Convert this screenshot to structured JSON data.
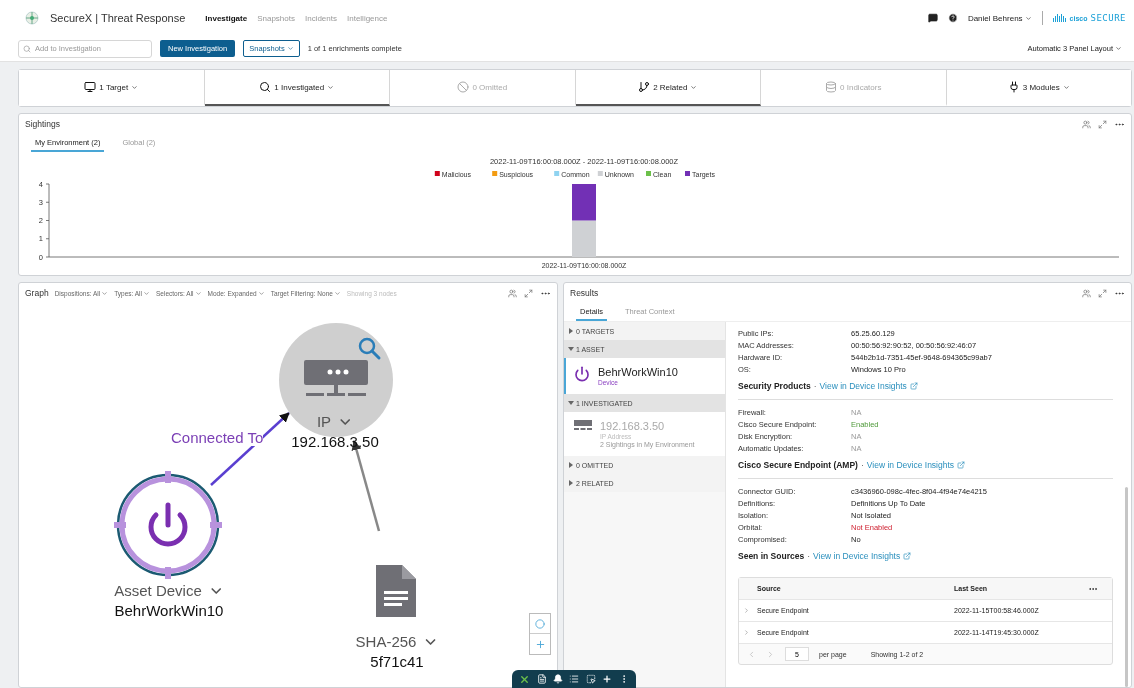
{
  "header": {
    "app_title": "SecureX | Threat Response",
    "nav": [
      {
        "label": "Investigate",
        "selected": true
      },
      {
        "label": "Snapshots",
        "selected": false
      },
      {
        "label": "Incidents",
        "selected": false
      },
      {
        "label": "Intelligence",
        "selected": false
      }
    ],
    "user": "Daniel Behrens",
    "brand_small": "cisco",
    "brand": "SECURE"
  },
  "toolbar": {
    "search_placeholder": "Add to Investigation",
    "new_button": "New Investigation",
    "snapshots_button": "Snapshots",
    "status": "1 of 1 enrichments complete",
    "layout": "Automatic 3 Panel Layout"
  },
  "summary": [
    {
      "kind": "target",
      "label": "1 Target",
      "selected": false,
      "disabled": false
    },
    {
      "kind": "investigated",
      "label": "1 Investigated",
      "selected": true,
      "disabled": false
    },
    {
      "kind": "omitted",
      "label": "0 Omitted",
      "selected": false,
      "disabled": true
    },
    {
      "kind": "related",
      "label": "2 Related",
      "selected": true,
      "disabled": false
    },
    {
      "kind": "indicators",
      "label": "0 Indicators",
      "selected": false,
      "disabled": true
    },
    {
      "kind": "modules",
      "label": "3 Modules",
      "selected": false,
      "disabled": false
    }
  ],
  "sightings": {
    "title": "Sightings",
    "tabs": [
      {
        "label": "My Environment (2)",
        "selected": true
      },
      {
        "label": "Global (2)",
        "selected": false
      }
    ],
    "chart_data": {
      "type": "bar",
      "title": "2022-11-09T16:00:08.000Z - 2022-11-09T16:00:08.000Z",
      "categories": [
        "2022-11-09T16:00:08.000Z"
      ],
      "stacked": true,
      "ylim": [
        0,
        4
      ],
      "yticks": [
        0,
        1,
        2,
        3,
        4
      ],
      "legend": "top",
      "series": [
        {
          "name": "Malicious",
          "color": "#d0021b",
          "values": [
            0
          ]
        },
        {
          "name": "Suspicious",
          "color": "#f39c12",
          "values": [
            0
          ]
        },
        {
          "name": "Common",
          "color": "#8fd3f0",
          "values": [
            0
          ]
        },
        {
          "name": "Unknown",
          "color": "#cfd1d4",
          "values": [
            2
          ]
        },
        {
          "name": "Clean",
          "color": "#6cc04a",
          "values": [
            0
          ]
        },
        {
          "name": "Targets",
          "color": "#7230b5",
          "values": [
            2
          ]
        }
      ]
    }
  },
  "graph": {
    "title": "Graph",
    "filters": [
      "Dispositions: All",
      "Types: All",
      "Selectors: All",
      "Mode: Expanded",
      "Target Filtering: None"
    ],
    "node_count": "Showing 3 nodes",
    "nodes": [
      {
        "kind": "ip",
        "type": "IP",
        "value": "192.168.3.50"
      },
      {
        "kind": "asset",
        "type": "Asset Device",
        "value": "BehrWorkWin10"
      },
      {
        "kind": "file",
        "type": "SHA-256",
        "value": "5f71c41"
      }
    ],
    "edges": [
      {
        "kind": "labeled",
        "label": "Connected To"
      },
      {
        "kind": "plain"
      }
    ]
  },
  "results": {
    "title": "Results",
    "tabs": [
      {
        "label": "Details",
        "selected": true
      },
      {
        "label": "Threat Context",
        "selected": false
      }
    ],
    "groups": [
      {
        "label": "0 TARGETS",
        "expanded": false
      },
      {
        "label": "1 ASSET",
        "expanded": true,
        "items": [
          {
            "kind": "device",
            "name": "BehrWorkWin10",
            "type": "Device",
            "selected": true
          }
        ]
      },
      {
        "label": "1 INVESTIGATED",
        "expanded": true,
        "items": [
          {
            "kind": "ip",
            "name": "192.168.3.50",
            "type": "IP Address",
            "note": "2 Sightings in My Environment",
            "selected": false
          }
        ]
      },
      {
        "label": "0 OMITTED",
        "expanded": false
      },
      {
        "label": "2 RELATED",
        "expanded": false
      }
    ],
    "details": [
      {
        "kind": "properties",
        "rows": [
          {
            "label": "Public IPs:",
            "value": "65.25.60.129",
            "kind": "plain"
          },
          {
            "label": "MAC Addresses:",
            "value": "00:50:56:92:90:52, 00:50:56:92:46:07",
            "kind": "plain"
          },
          {
            "label": "Hardware ID:",
            "value": "544b2b1d-7351-45ef-9648-694365c99ab7",
            "kind": "plain"
          },
          {
            "label": "OS:",
            "value": "Windows 10 Pro",
            "kind": "plain"
          }
        ]
      },
      {
        "kind": "heading",
        "title": "Security Products",
        "separator": "·",
        "link": "View in Device Insights"
      },
      {
        "kind": "properties",
        "rows": [
          {
            "label": "Firewall:",
            "value": "NA",
            "kind": "unavailable"
          },
          {
            "label": "Cisco Secure Endpoint:",
            "value": "Enabled",
            "kind": "positive"
          },
          {
            "label": "Disk Encryption:",
            "value": "NA",
            "kind": "unavailable"
          },
          {
            "label": "Automatic Updates:",
            "value": "NA",
            "kind": "unavailable"
          }
        ]
      },
      {
        "kind": "heading",
        "title": "Cisco Secure Endpoint (AMP)",
        "separator": "·",
        "link": "View in Device Insights"
      },
      {
        "kind": "properties",
        "rows": [
          {
            "label": "Connector GUID:",
            "value": "c3436960-098c-4fec-8f04-4f94e74e4215",
            "kind": "plain"
          },
          {
            "label": "Definitions:",
            "value": "Definitions Up To Date",
            "kind": "plain"
          },
          {
            "label": "Isolation:",
            "value": "Not Isolated",
            "kind": "plain"
          },
          {
            "label": "Orbital:",
            "value": "Not Enabled",
            "kind": "negative"
          },
          {
            "label": "Compromised:",
            "value": "No",
            "kind": "plain"
          }
        ]
      },
      {
        "kind": "heading",
        "title": "Seen in Sources",
        "separator": "·",
        "link": "View in Device Insights"
      },
      {
        "kind": "sources",
        "columns": [
          "Source",
          "Last Seen"
        ],
        "rows": [
          {
            "source": "Secure Endpoint",
            "last_seen": "2022-11-15T00:58:46.000Z",
            "expanded": false
          },
          {
            "source": "Secure Endpoint",
            "last_seen": "2022-11-14T19:45:30.000Z",
            "expanded": false
          }
        ],
        "page_size": "5",
        "per_page": "per page",
        "range": "Showing 1-2 of 2"
      }
    ]
  }
}
